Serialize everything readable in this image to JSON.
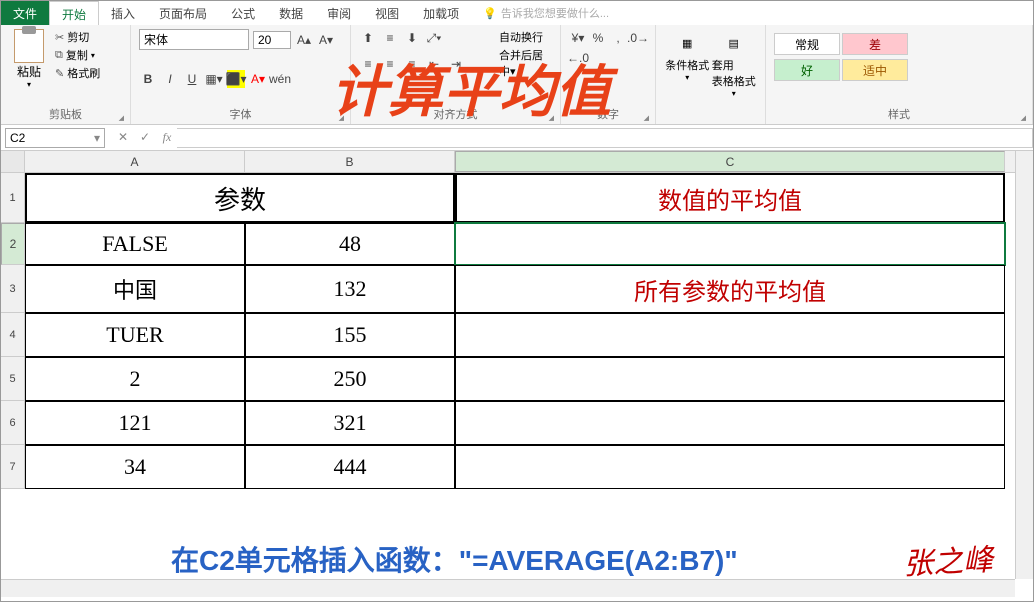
{
  "tabs": {
    "file": "文件",
    "home": "开始",
    "insert": "插入",
    "layout": "页面布局",
    "formulas": "公式",
    "data": "数据",
    "review": "审阅",
    "view": "视图",
    "addins": "加载项",
    "tellme": "告诉我您想要做什么..."
  },
  "clipboard": {
    "paste": "粘贴",
    "cut": "剪切",
    "copy": "复制",
    "painter": "格式刷",
    "label": "剪贴板"
  },
  "font": {
    "name": "宋体",
    "size": "20",
    "label": "字体"
  },
  "alignment": {
    "label": "对齐方式"
  },
  "number": {
    "label": "数字"
  },
  "condfmt": {
    "cond": "条件格式",
    "table": "套用\n表格格式"
  },
  "styles": {
    "normal": "常规",
    "bad": "差",
    "good": "好",
    "neutral": "适中",
    "label": "样式"
  },
  "namebox": "C2",
  "columns": [
    "A",
    "B",
    "C"
  ],
  "col_widths": {
    "A": 220,
    "B": 210,
    "C": 550
  },
  "rows": [
    1,
    2,
    3,
    4,
    5,
    6,
    7
  ],
  "row_heights": {
    "1": 50,
    "2": 42,
    "3": 48,
    "4": 44,
    "5": 44,
    "6": 44,
    "7": 44
  },
  "table": {
    "header_param": "参数",
    "header_avg": "数值的平均值",
    "all_avg": "所有参数的平均值",
    "data": [
      {
        "A": "FALSE",
        "B": "48"
      },
      {
        "A": "中国",
        "B": "132"
      },
      {
        "A": "TUER",
        "B": "155"
      },
      {
        "A": "2",
        "B": "250"
      },
      {
        "A": "121",
        "B": "321"
      },
      {
        "A": "34",
        "B": "444"
      }
    ]
  },
  "overlay": {
    "title": "计算平均值",
    "formula": "在C2单元格插入函数：\"=AVERAGE(A2:B7)\"",
    "sig": "张之峰"
  }
}
